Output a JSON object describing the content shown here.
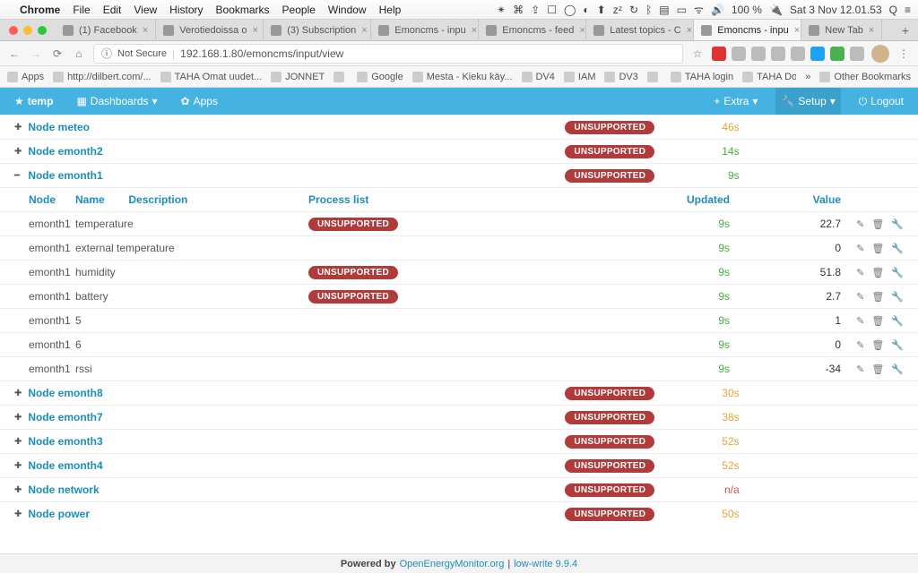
{
  "menubar": {
    "app": "Chrome",
    "items": [
      "File",
      "Edit",
      "View",
      "History",
      "Bookmarks",
      "People",
      "Window",
      "Help"
    ],
    "battery": "100 %",
    "clock": "Sat 3 Nov  12.01.53"
  },
  "tabs": [
    {
      "label": "(1) Facebook",
      "active": false
    },
    {
      "label": "Verotiedoissa o",
      "active": false
    },
    {
      "label": "(3) Subscription",
      "active": false
    },
    {
      "label": "Emoncms - inpu",
      "active": false
    },
    {
      "label": "Emoncms - feed",
      "active": false
    },
    {
      "label": "Latest topics - C",
      "active": false
    },
    {
      "label": "Emoncms - inpu",
      "active": true
    },
    {
      "label": "New Tab",
      "active": false
    }
  ],
  "address": {
    "secure_label": "Not Secure",
    "url": "192.168.1.80/emoncms/input/view"
  },
  "bookmarks": [
    "Apps",
    "http://dilbert.com/...",
    "TAHA Omat uudet...",
    "JONNET",
    "",
    "Google",
    "Mesta - Kieku käy...",
    "DV4",
    "IAM",
    "DV3",
    "",
    "TAHA login",
    "TAHA Domain_tech"
  ],
  "bookmarks_overflow": "Other Bookmarks",
  "appnav": {
    "brand": "temp",
    "dash": "Dashboards",
    "apps": "Apps",
    "extra": "Extra",
    "setup": "Setup",
    "logout": "Logout"
  },
  "headers": {
    "node": "Node",
    "name": "Name",
    "desc": "Description",
    "proc": "Process list",
    "upd": "Updated",
    "val": "Value"
  },
  "unsupported": "UNSUPPORTED",
  "groups_top": [
    {
      "name": "Node meteo",
      "upd": "46s",
      "upd_cls": "upd-orange",
      "toggle": "+"
    },
    {
      "name": "Node emonth2",
      "upd": "14s",
      "upd_cls": "upd-green",
      "toggle": "+"
    },
    {
      "name": "Node emonth1",
      "upd": "9s",
      "upd_cls": "upd-green",
      "toggle": "–"
    }
  ],
  "inputs": [
    {
      "node": "emonth1",
      "name": "temperature",
      "proc": true,
      "upd": "9s",
      "val": "22.7"
    },
    {
      "node": "emonth1",
      "name": "external temperature",
      "proc": false,
      "upd": "9s",
      "val": "0"
    },
    {
      "node": "emonth1",
      "name": "humidity",
      "proc": true,
      "upd": "9s",
      "val": "51.8"
    },
    {
      "node": "emonth1",
      "name": "battery",
      "proc": true,
      "upd": "9s",
      "val": "2.7"
    },
    {
      "node": "emonth1",
      "name": "5",
      "proc": false,
      "upd": "9s",
      "val": "1"
    },
    {
      "node": "emonth1",
      "name": "6",
      "proc": false,
      "upd": "9s",
      "val": "0"
    },
    {
      "node": "emonth1",
      "name": "rssi",
      "proc": false,
      "upd": "9s",
      "val": "-34"
    }
  ],
  "groups_bottom": [
    {
      "name": "Node emonth8",
      "upd": "30s",
      "upd_cls": "upd-orange"
    },
    {
      "name": "Node emonth7",
      "upd": "38s",
      "upd_cls": "upd-orange"
    },
    {
      "name": "Node emonth3",
      "upd": "52s",
      "upd_cls": "upd-orange"
    },
    {
      "name": "Node emonth4",
      "upd": "52s",
      "upd_cls": "upd-orange"
    },
    {
      "name": "Node network",
      "upd": "n/a",
      "upd_cls": "upd-red"
    },
    {
      "name": "Node power",
      "upd": "50s",
      "upd_cls": "upd-orange"
    }
  ],
  "footer": {
    "pre": "Powered by ",
    "link1": "OpenEnergyMonitor.org",
    "sep": " | ",
    "link2": "low-write 9.9.4"
  }
}
